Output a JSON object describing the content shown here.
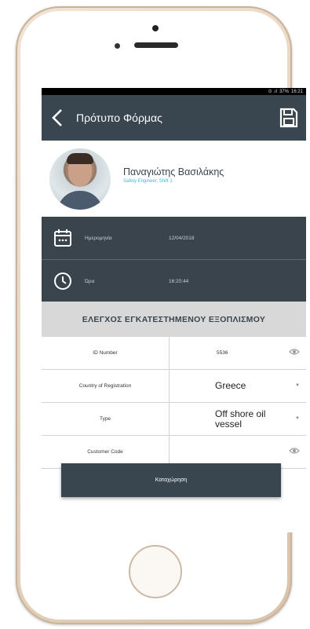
{
  "status_bar": {
    "signal": "⊙ .ıl",
    "battery": "37%",
    "time": "16:21"
  },
  "app_bar": {
    "title": "Πρότυπο Φόρμας",
    "back_icon": "chevron-left-icon",
    "save_icon": "floppy-disk-icon"
  },
  "profile": {
    "name": "Παναγιώτης Βασιλάκης",
    "role": "Safety Engineer, Shift 1"
  },
  "info": {
    "date_label": "Ημερομηνία",
    "date_value": "12/04/2018",
    "time_label": "Ώρα",
    "time_value": "16:20:44"
  },
  "section": {
    "title": "ΕΛΕΓΧΟΣ ΕΓΚΑΤΕΣΤΗΜΕΝΟΥ ΕΞΟΠΛΙΣΜΟΥ"
  },
  "form": {
    "rows": [
      {
        "label": "ID Number",
        "value": "5536"
      },
      {
        "label": "Country of Registration",
        "value": "Greece"
      },
      {
        "label": "Type",
        "value_line1": "Off shore oil",
        "value_line2": "vessel"
      },
      {
        "label": "Customer Code",
        "value": ""
      }
    ]
  },
  "submit": {
    "label": "Καταχώρηση"
  },
  "colors": {
    "dark": "#39454f",
    "accent": "#3fb6e0",
    "section_bg": "#d8d8d8"
  }
}
